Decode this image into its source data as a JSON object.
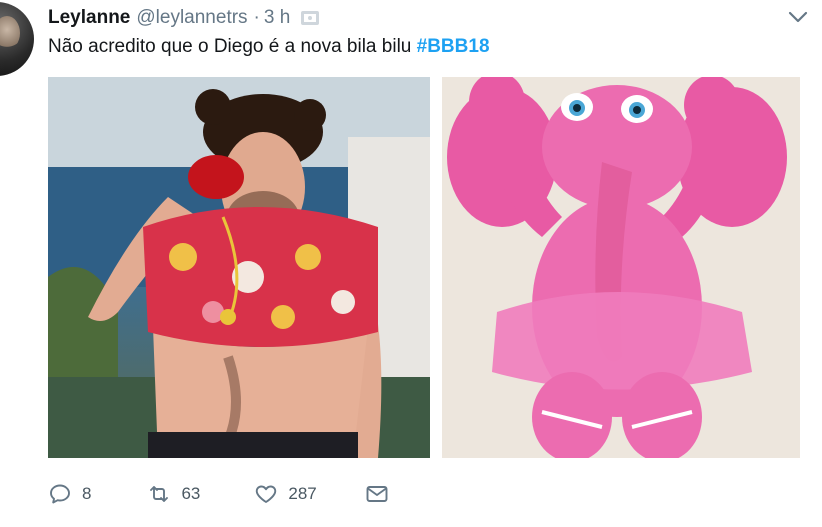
{
  "tweet": {
    "display_name": "Leylanne",
    "handle": "@leylannetrs",
    "separator": "·",
    "time": "3 h",
    "text_prefix": "Não acredito que o Diego é a nova bila bilu",
    "hashtag": "#BBB18"
  },
  "actions": {
    "reply_count": "8",
    "retweet_count": "63",
    "like_count": "287"
  },
  "colors": {
    "link": "#1da1f2",
    "secondary_text": "#657786"
  }
}
